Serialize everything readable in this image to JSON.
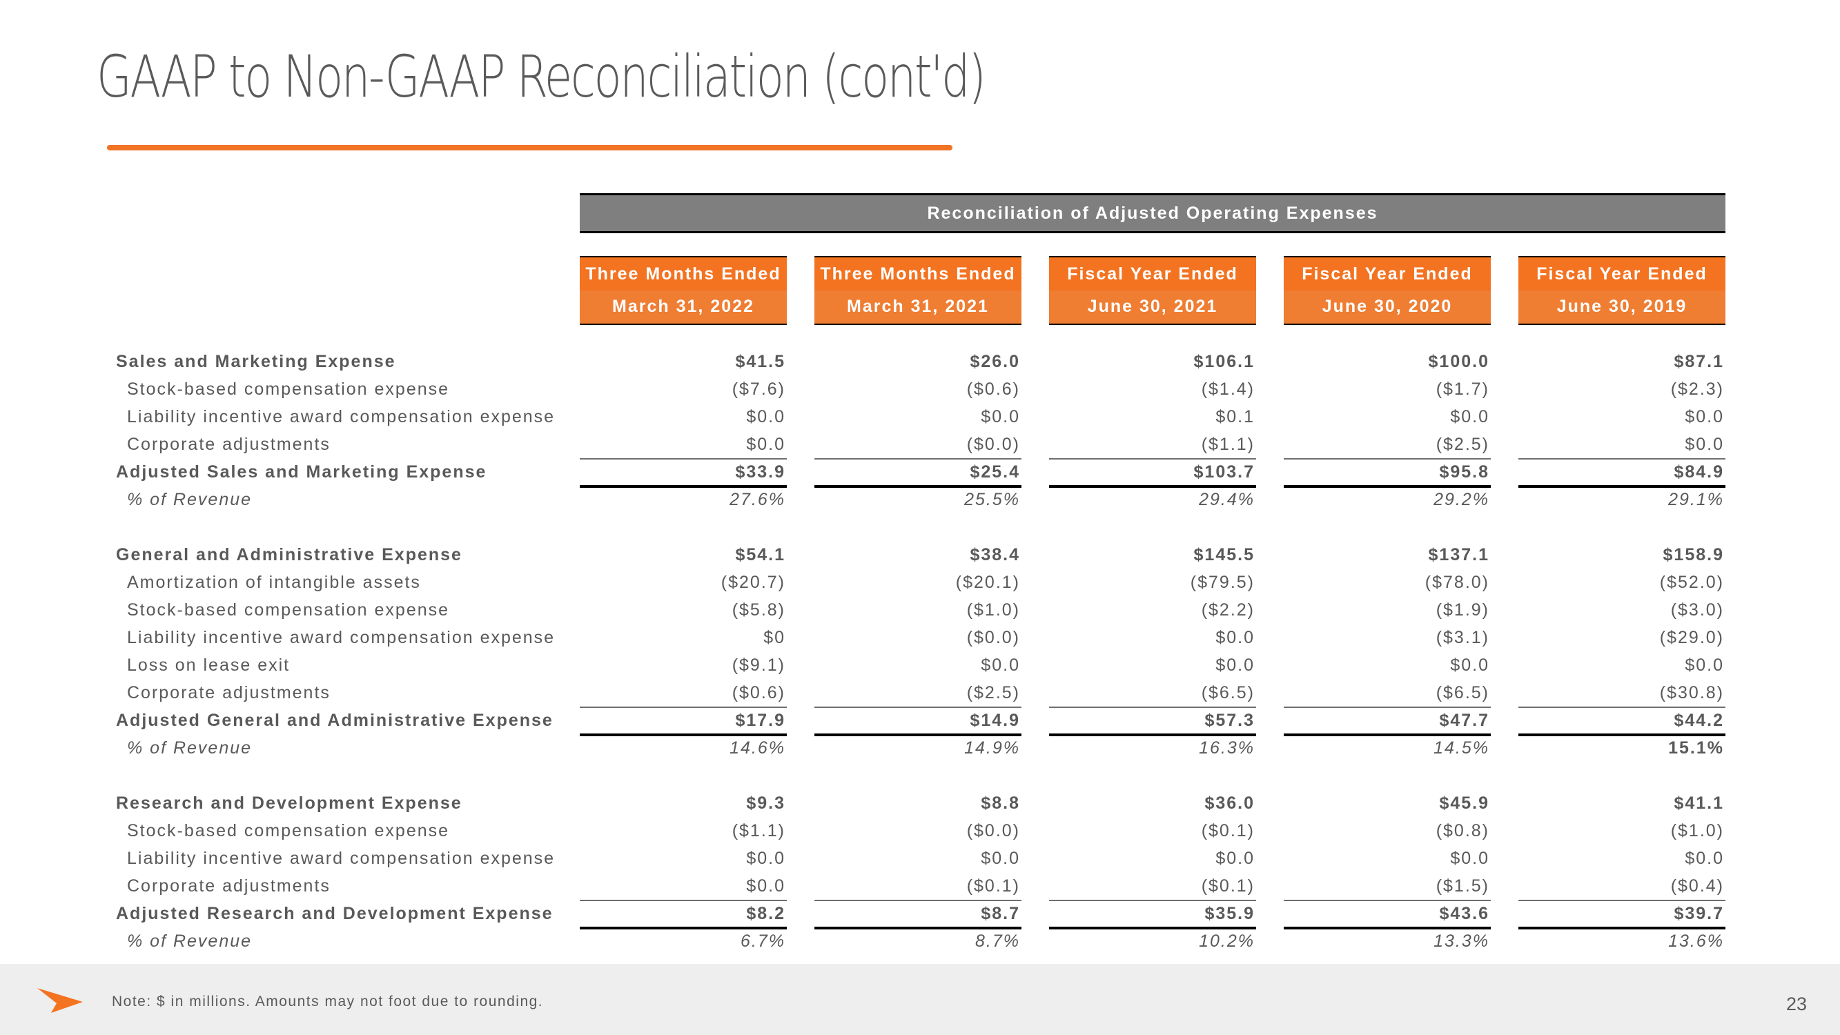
{
  "title": "GAAP to Non-GAAP Reconciliation (cont'd)",
  "table": {
    "band_title": "Reconciliation of Adjusted Operating Expenses",
    "columns": [
      {
        "line1": "Three Months Ended",
        "line2": "March 31, 2022"
      },
      {
        "line1": "Three Months Ended",
        "line2": "March 31, 2021"
      },
      {
        "line1": "Fiscal Year Ended",
        "line2": "June 30, 2021"
      },
      {
        "line1": "Fiscal Year Ended",
        "line2": "June 30, 2020"
      },
      {
        "line1": "Fiscal Year Ended",
        "line2": "June 30, 2019"
      }
    ],
    "sections": [
      {
        "rows": [
          {
            "label": "Sales and Marketing Expense",
            "style": "bold",
            "values": [
              "$41.5",
              "$26.0",
              "$106.1",
              "$100.0",
              "$87.1"
            ]
          },
          {
            "label": "Stock-based compensation expense",
            "style": "sub",
            "values": [
              "($7.6)",
              "($0.6)",
              "($1.4)",
              "($1.7)",
              "($2.3)"
            ]
          },
          {
            "label": "Liability incentive award compensation expense",
            "style": "sub",
            "values": [
              "$0.0",
              "$0.0",
              "$0.1",
              "$0.0",
              "$0.0"
            ]
          },
          {
            "label": "Corporate adjustments",
            "style": "sub",
            "values": [
              "$0.0",
              "($0.0)",
              "($1.1)",
              "($2.5)",
              "$0.0"
            ]
          },
          {
            "label": "Adjusted Sales and Marketing Expense",
            "style": "total",
            "values": [
              "$33.9",
              "$25.4",
              "$103.7",
              "$95.8",
              "$84.9"
            ]
          },
          {
            "label": "% of Revenue",
            "style": "pct",
            "values": [
              "27.6%",
              "25.5%",
              "29.4%",
              "29.2%",
              "29.1%"
            ]
          }
        ]
      },
      {
        "rows": [
          {
            "label": "General and Administrative Expense",
            "style": "bold",
            "values": [
              "$54.1",
              "$38.4",
              "$145.5",
              "$137.1",
              "$158.9"
            ]
          },
          {
            "label": "Amortization of intangible assets",
            "style": "sub",
            "values": [
              "($20.7)",
              "($20.1)",
              "($79.5)",
              "($78.0)",
              "($52.0)"
            ]
          },
          {
            "label": "Stock-based compensation expense",
            "style": "sub",
            "values": [
              "($5.8)",
              "($1.0)",
              "($2.2)",
              "($1.9)",
              "($3.0)"
            ]
          },
          {
            "label": "Liability incentive award compensation expense",
            "style": "sub",
            "values": [
              "$0",
              "($0.0)",
              "$0.0",
              "($3.1)",
              "($29.0)"
            ]
          },
          {
            "label": "Loss on lease exit",
            "style": "sub",
            "values": [
              "($9.1)",
              "$0.0",
              "$0.0",
              "$0.0",
              "$0.0"
            ]
          },
          {
            "label": "Corporate adjustments",
            "style": "sub",
            "values": [
              "($0.6)",
              "($2.5)",
              "($6.5)",
              "($6.5)",
              "($30.8)"
            ]
          },
          {
            "label": "Adjusted General and Administrative Expense",
            "style": "total",
            "values": [
              "$17.9",
              "$14.9",
              "$57.3",
              "$47.7",
              "$44.2"
            ]
          },
          {
            "label": "% of Revenue",
            "style": "pct",
            "values": [
              "14.6%",
              "14.9%",
              "16.3%",
              "14.5%",
              "15.1%"
            ],
            "bold_cells": [
              4
            ]
          }
        ]
      },
      {
        "rows": [
          {
            "label": "Research and Development Expense",
            "style": "bold",
            "values": [
              "$9.3",
              "$8.8",
              "$36.0",
              "$45.9",
              "$41.1"
            ]
          },
          {
            "label": "Stock-based compensation expense",
            "style": "sub",
            "values": [
              "($1.1)",
              "($0.0)",
              "($0.1)",
              "($0.8)",
              "($1.0)"
            ]
          },
          {
            "label": "Liability incentive award compensation expense",
            "style": "sub",
            "values": [
              "$0.0",
              "$0.0",
              "$0.0",
              "$0.0",
              "$0.0"
            ]
          },
          {
            "label": "Corporate adjustments",
            "style": "sub",
            "values": [
              "$0.0",
              "($0.1)",
              "($0.1)",
              "($1.5)",
              "($0.4)"
            ]
          },
          {
            "label": "Adjusted Research and Development Expense",
            "style": "total",
            "values": [
              "$8.2",
              "$8.7",
              "$35.9",
              "$43.6",
              "$39.7"
            ]
          },
          {
            "label": "% of Revenue",
            "style": "pct",
            "values": [
              "6.7%",
              "8.7%",
              "10.2%",
              "13.3%",
              "13.6%"
            ]
          }
        ]
      }
    ]
  },
  "footer": {
    "note": "Note: $ in millions. Amounts may not foot due to rounding.",
    "page_number": "23",
    "arrow_icon": "orange-arrow-logo"
  },
  "colors": {
    "accent": "#f37321",
    "band": "#7f7f7f",
    "text": "#595959",
    "footer_bg": "#eeeeee"
  }
}
